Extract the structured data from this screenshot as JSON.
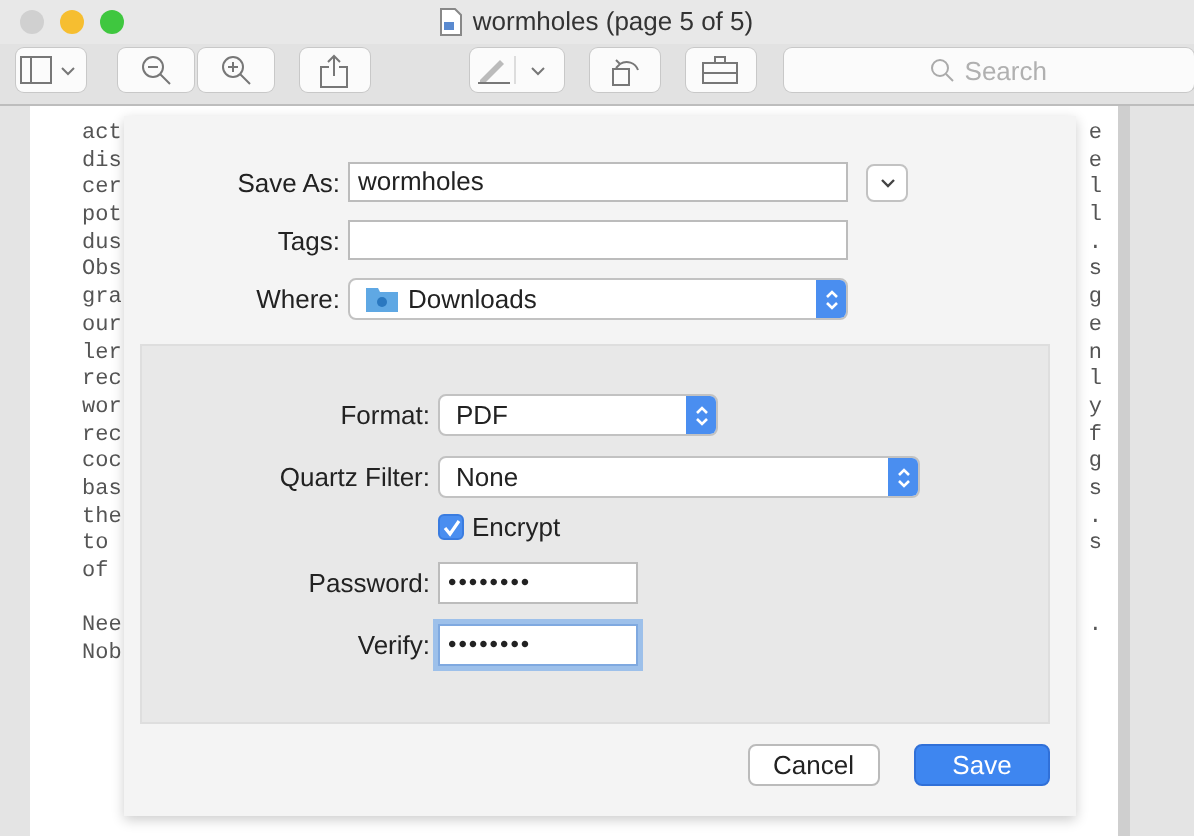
{
  "window": {
    "title": "wormholes (page 5 of 5)"
  },
  "toolbar": {
    "search": {
      "placeholder": "Search"
    }
  },
  "document": {
    "lines": [
      {
        "start": "act",
        "end": "e"
      },
      {
        "start": "dis",
        "end": "e"
      },
      {
        "start": "cer",
        "end": "l"
      },
      {
        "start": "pot",
        "end": "l"
      },
      {
        "start": "dus",
        "end": "."
      },
      {
        "start": "Obs",
        "end": "s"
      },
      {
        "start": "gra",
        "end": "g"
      },
      {
        "start": "our",
        "end": "e"
      },
      {
        "start": "ler",
        "end": "n"
      },
      {
        "start": "rec",
        "end": "l"
      },
      {
        "start": "wor",
        "end": "y"
      },
      {
        "start": "rec",
        "end": "f"
      },
      {
        "start": "coc",
        "end": "g"
      },
      {
        "start": "bas",
        "end": "s"
      },
      {
        "start": "the",
        "end": "."
      },
      {
        "start": "to",
        "end": "s"
      },
      {
        "start": "of"
      },
      {
        "start": "Nee",
        "end": ".",
        "gap_before": true
      },
      {
        "start": "Nob"
      }
    ]
  },
  "dialog": {
    "save_as": {
      "label": "Save As:",
      "value": "wormholes"
    },
    "tags": {
      "label": "Tags:"
    },
    "where": {
      "label": "Where:",
      "value": "Downloads"
    },
    "format": {
      "label": "Format:",
      "value": "PDF"
    },
    "quartz_filter": {
      "label": "Quartz Filter:",
      "value": "None"
    },
    "encrypt": {
      "label": "Encrypt",
      "checked": true
    },
    "password": {
      "label": "Password:",
      "value": "••••••••",
      "focused": false
    },
    "verify": {
      "label": "Verify:",
      "value": "••••••••",
      "focused": true
    },
    "buttons": [
      {
        "label": "Cancel",
        "default": false
      },
      {
        "label": "Save",
        "default": true
      }
    ]
  }
}
